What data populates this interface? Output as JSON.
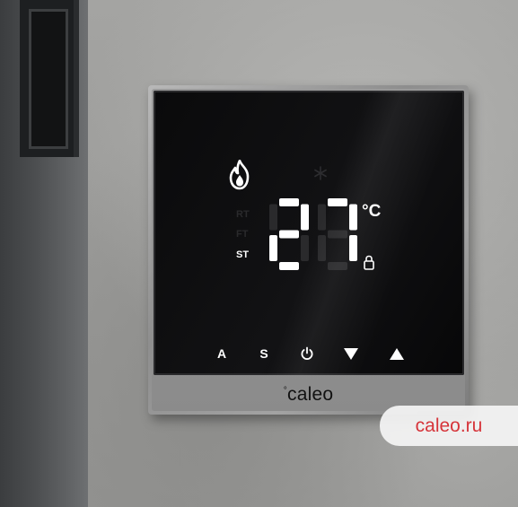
{
  "device": {
    "brand": "caleo",
    "brand_mark": "°"
  },
  "display": {
    "temperature": "27",
    "unit": "°C",
    "mode_labels": [
      {
        "label": "RT",
        "active": false
      },
      {
        "label": "FT",
        "active": false
      },
      {
        "label": "ST",
        "active": true
      }
    ],
    "heating_icon": "flame-icon",
    "cooling_icon": "snowflake-icon",
    "lock_icon": "lock-icon"
  },
  "buttons": [
    {
      "label": "A",
      "name": "mode-a-button"
    },
    {
      "label": "S",
      "name": "mode-s-button"
    },
    {
      "label": "",
      "name": "power-button",
      "icon": "power-icon"
    },
    {
      "label": "",
      "name": "down-button",
      "icon": "triangle-down-icon"
    },
    {
      "label": "",
      "name": "up-button",
      "icon": "triangle-up-icon"
    }
  ],
  "watermark": {
    "text": "caleo.ru",
    "color": "#d6343a"
  },
  "colors": {
    "screen": "#0e0e10",
    "frame": "#9a9a9a",
    "display_on": "#ffffff",
    "display_off": "#2a2a2c"
  }
}
